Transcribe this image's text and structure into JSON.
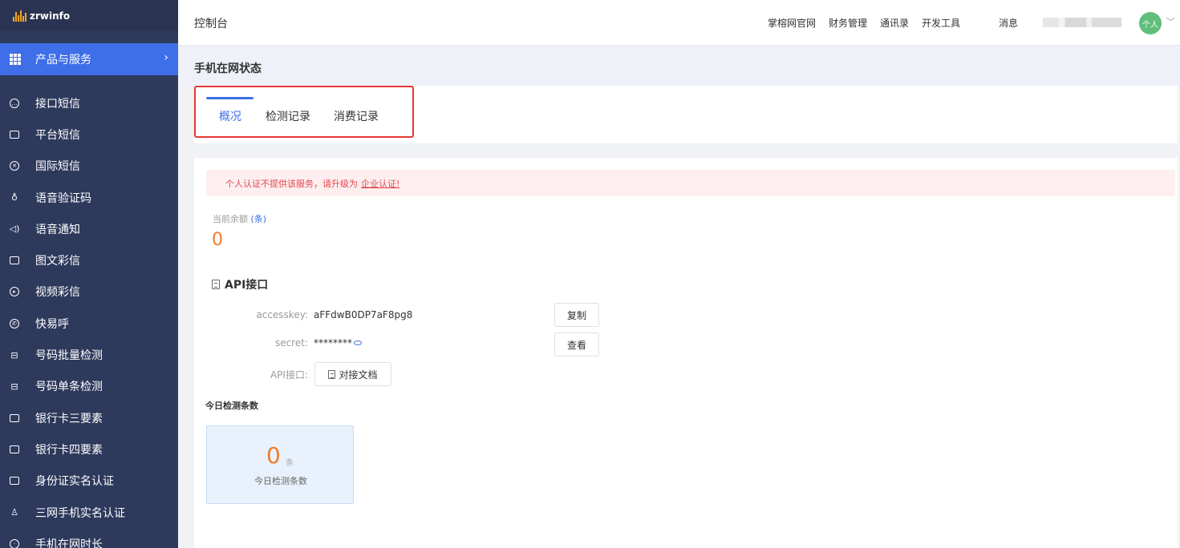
{
  "brand": {
    "name": "zrwinfo",
    "accent": "#3e6ee8",
    "sidebar_bg": "#2e3a5c"
  },
  "sidebar": {
    "product_menu": {
      "label": "产品与服务",
      "icon": "grid-icon"
    },
    "items": [
      {
        "label": "接口短信",
        "icon": "chat-icon"
      },
      {
        "label": "平台短信",
        "icon": "message-icon"
      },
      {
        "label": "国际短信",
        "icon": "globe-icon"
      },
      {
        "label": "语音验证码",
        "icon": "microphone-icon"
      },
      {
        "label": "语音通知",
        "icon": "speaker-icon"
      },
      {
        "label": "图文彩信",
        "icon": "image-icon"
      },
      {
        "label": "视频彩信",
        "icon": "play-icon"
      },
      {
        "label": "快易呼",
        "icon": "phone-circle-icon"
      },
      {
        "label": "号码批量检测",
        "icon": "scan-icon"
      },
      {
        "label": "号码单条检测",
        "icon": "scan-icon"
      },
      {
        "label": "银行卡三要素",
        "icon": "card-icon"
      },
      {
        "label": "银行卡四要素",
        "icon": "card-icon"
      },
      {
        "label": "身份证实名认证",
        "icon": "id-card-icon"
      },
      {
        "label": "三网手机实名认证",
        "icon": "user-icon"
      },
      {
        "label": "手机在网时长",
        "icon": "clock-icon"
      }
    ]
  },
  "header": {
    "title": "控制台",
    "links": [
      "掌榕网官网",
      "财务管理",
      "通讯录",
      "开发工具"
    ],
    "messages": "消息",
    "avatar": "个人"
  },
  "page": {
    "title": "手机在网状态",
    "tabs": [
      "概况",
      "检测记录",
      "消费记录"
    ],
    "active_tab": "概况"
  },
  "alert": {
    "text": "个人认证不提供该服务，请升级为",
    "link": "企业认证!"
  },
  "balance": {
    "label": "当前余额",
    "unit": "(条)",
    "value": "0"
  },
  "api": {
    "title": "API接口",
    "accesskey_label": "accesskey:",
    "accesskey_value": "aFFdwB0DP7aF8pg8",
    "copy_button": "复制",
    "secret_label": "secret:",
    "secret_value": "********",
    "view_button": "查看",
    "api_label": "API接口:",
    "doc_button": "对接文档"
  },
  "today": {
    "title": "今日检测条数",
    "value": "0",
    "unit": "条",
    "label": "今日检测条数"
  }
}
